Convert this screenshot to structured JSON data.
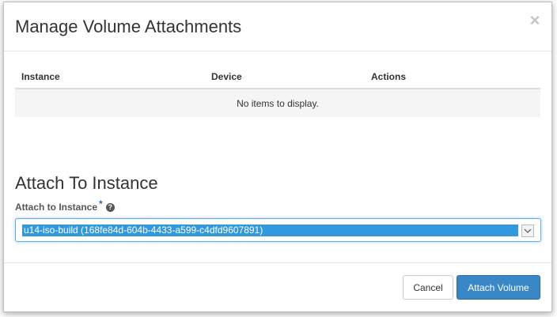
{
  "modal": {
    "title": "Manage Volume Attachments",
    "close_glyph": "×"
  },
  "attachments_table": {
    "columns": [
      "Instance",
      "Device",
      "Actions"
    ],
    "empty_message": "No items to display."
  },
  "attach_section": {
    "title": "Attach To Instance",
    "field_label": "Attach to Instance",
    "required_marker": "*",
    "help_glyph": "?",
    "selected_value": "u14-iso-build (168fe84d-604b-4433-a599-c4dfd9607891)"
  },
  "footer": {
    "cancel_label": "Cancel",
    "submit_label": "Attach Volume"
  },
  "colors": {
    "primary": "#3a87c8",
    "selection": "#3399dd",
    "focus_border": "#66afe9"
  }
}
